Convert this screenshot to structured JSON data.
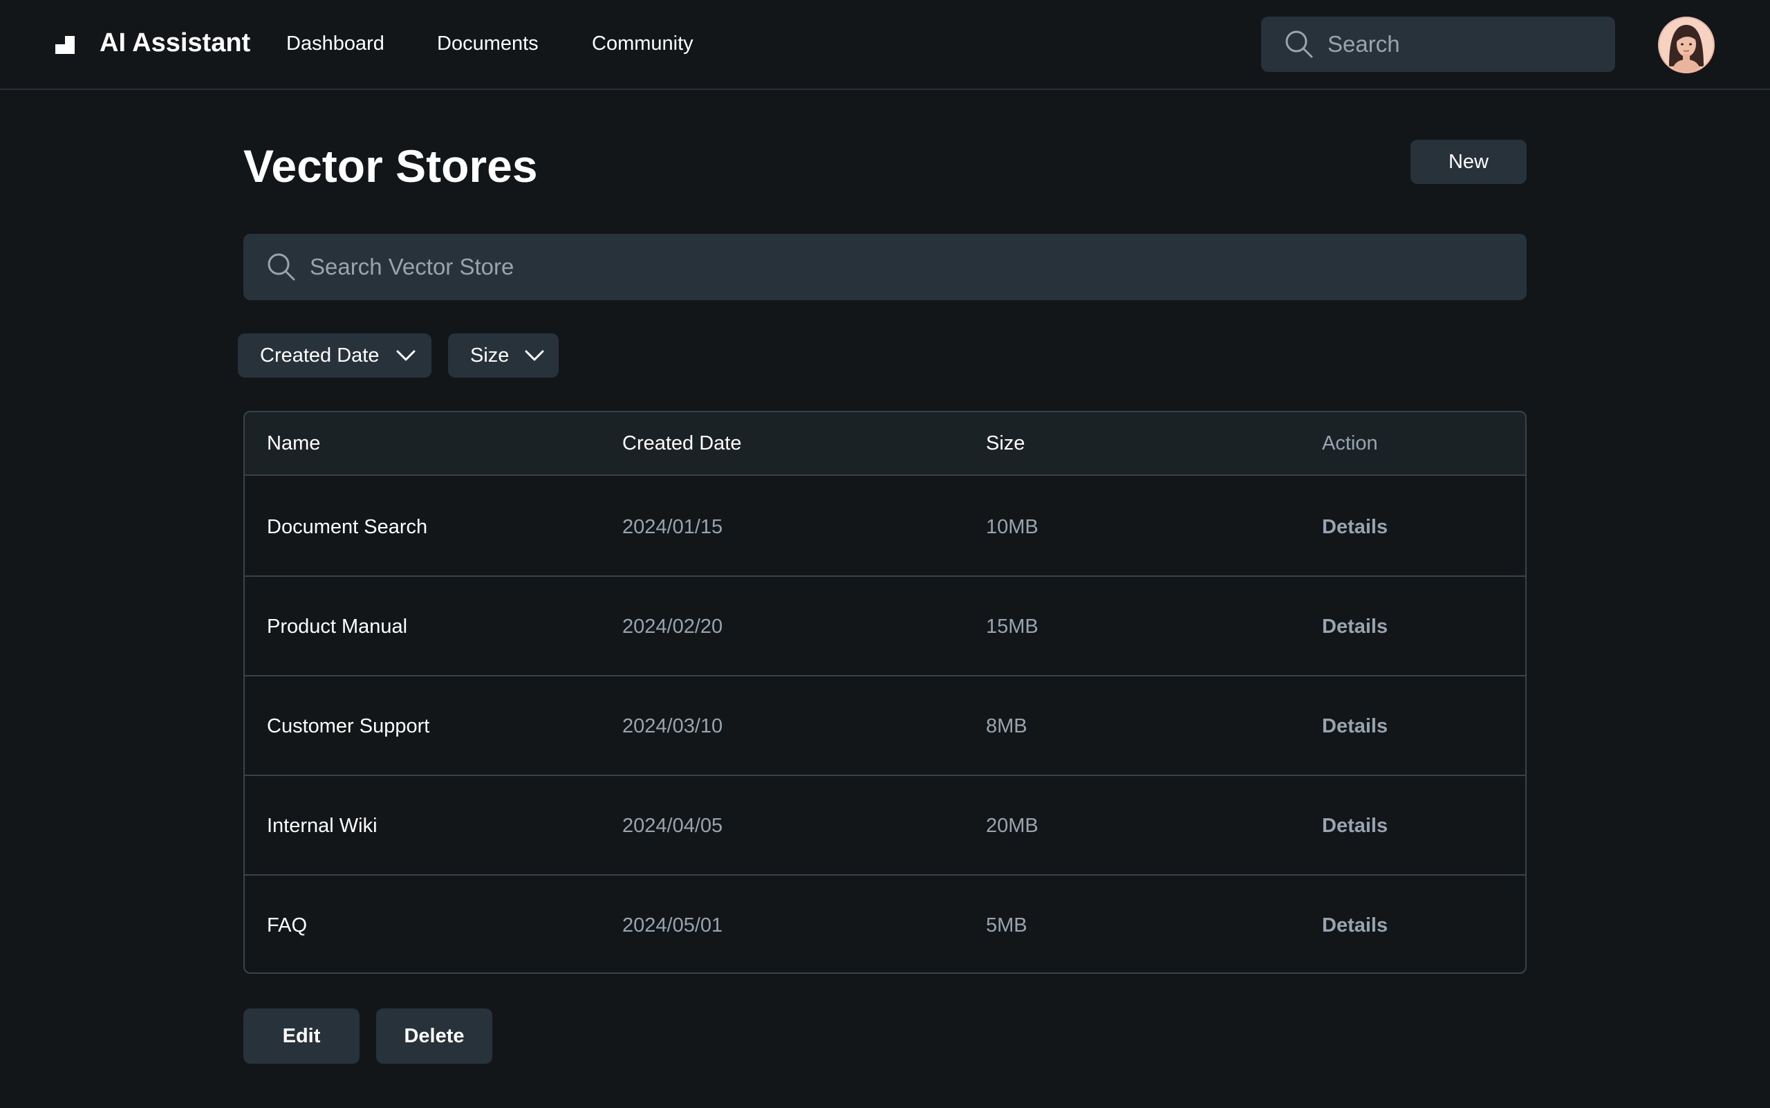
{
  "header": {
    "brand": "AI Assistant",
    "nav": [
      "Dashboard",
      "Documents",
      "Community"
    ],
    "search_placeholder": "Search"
  },
  "main": {
    "title": "Vector Stores",
    "new_button": "New",
    "search_placeholder": "Search Vector Store",
    "filters": [
      "Created Date",
      "Size"
    ]
  },
  "table": {
    "columns": [
      "Name",
      "Created Date",
      "Size",
      "Action"
    ],
    "rows": [
      {
        "name": "Document Search",
        "date": "2024/01/15",
        "size": "10MB",
        "action": "Details"
      },
      {
        "name": "Product Manual",
        "date": "2024/02/20",
        "size": "15MB",
        "action": "Details"
      },
      {
        "name": "Customer Support",
        "date": "2024/03/10",
        "size": "8MB",
        "action": "Details"
      },
      {
        "name": "Internal Wiki",
        "date": "2024/04/05",
        "size": "20MB",
        "action": "Details"
      },
      {
        "name": "FAQ",
        "date": "2024/05/01",
        "size": "5MB",
        "action": "Details"
      }
    ]
  },
  "actions": {
    "edit": "Edit",
    "delete": "Delete"
  },
  "icons": {
    "logo": "logo-icon",
    "search": "search-icon",
    "dropdown": "chevron-down-icon",
    "avatar": "avatar"
  },
  "colors": {
    "background": "#121619",
    "surface": "#28323a",
    "table_header": "#1b2226",
    "border": "#3a434a",
    "muted_text": "#98a4ae",
    "text": "#ffffff"
  }
}
